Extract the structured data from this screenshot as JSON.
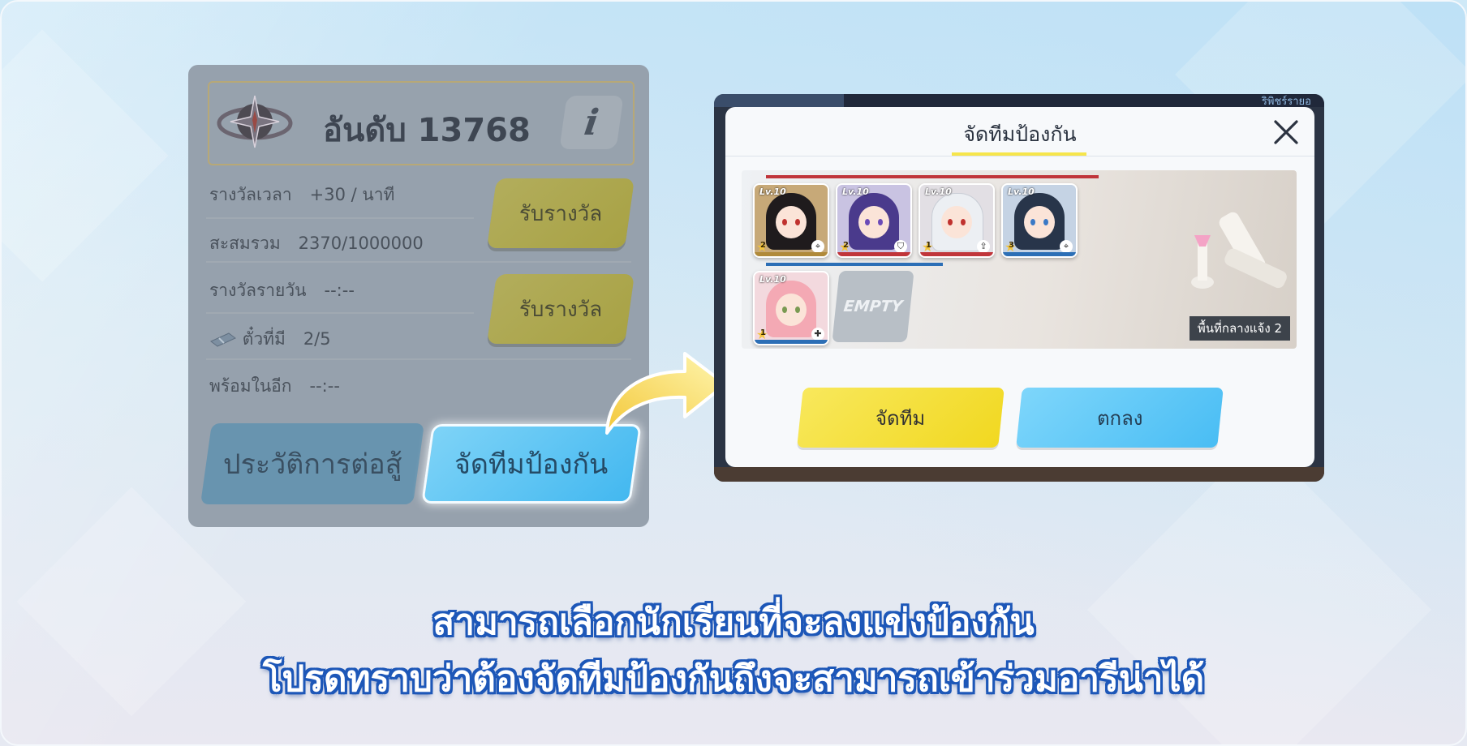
{
  "left_panel": {
    "rank_label": "อันดับ 13768",
    "info_label": "i",
    "rows": [
      {
        "label": "รางวัลเวลา",
        "value": "+30 / นาที"
      },
      {
        "label": "สะสมรวม",
        "value": "2370/1000000"
      },
      {
        "label": "รางวัลรายวัน",
        "value": "--:--"
      },
      {
        "label": "ตั๋วที่มี",
        "value": "2/5"
      },
      {
        "label": "พร้อมในอีก",
        "value": "--:--"
      }
    ],
    "claim_button_1": "รับรางวัล",
    "claim_button_2": "รับรางวัล",
    "history_button": "ประวัติการต่อสู้",
    "defense_button": "จัดทีมป้องกัน"
  },
  "dialog": {
    "title": "จัดทีมป้องกัน",
    "corner_text": "ริพิชร์รายอ",
    "cards": [
      {
        "level": "Lv.10",
        "stars": "2",
        "role_icon": "crosshair-icon",
        "hair": "#1f1b1d",
        "eye": "#c0322f",
        "bar": "#b08a3a"
      },
      {
        "level": "Lv.10",
        "stars": "2",
        "role_icon": "shield-icon",
        "hair": "#4a3a8c",
        "eye": "#6b4bb8",
        "bar": "#c0353a"
      },
      {
        "level": "Lv.10",
        "stars": "1",
        "role_icon": "upload-icon",
        "hair": "#eceff3",
        "eye": "#c0322f",
        "bar": "#c0353a"
      },
      {
        "level": "Lv.10",
        "stars": "3",
        "role_icon": "crosshair-icon",
        "hair": "#28354a",
        "eye": "#3b79c6",
        "bar": "#2c6fb6"
      },
      {
        "level": "Lv.10",
        "stars": "1",
        "role_icon": "heal-icon",
        "hair": "#f4a9b4",
        "eye": "#7a9a52",
        "bar": "#2c6fb6"
      }
    ],
    "empty_label": "EMPTY",
    "slot_badge": "พื้นที่กลางแจ้ง 2",
    "team_button": "จัดทีม",
    "ok_button": "ตกลง"
  },
  "caption": {
    "line1": "สามารถเลือกนักเรียนที่จะลงแข่งป้องกัน",
    "line2": "โปรดทราบว่าต้องจัดทีมป้องกันถึงจะสามารถเข้าร่วมอารีน่าได้"
  },
  "colors": {
    "caption_outline": "#1d57b8",
    "defense_button": "#43b8f0",
    "team_button": "#f1d820",
    "ok_button": "#49bdf4"
  }
}
